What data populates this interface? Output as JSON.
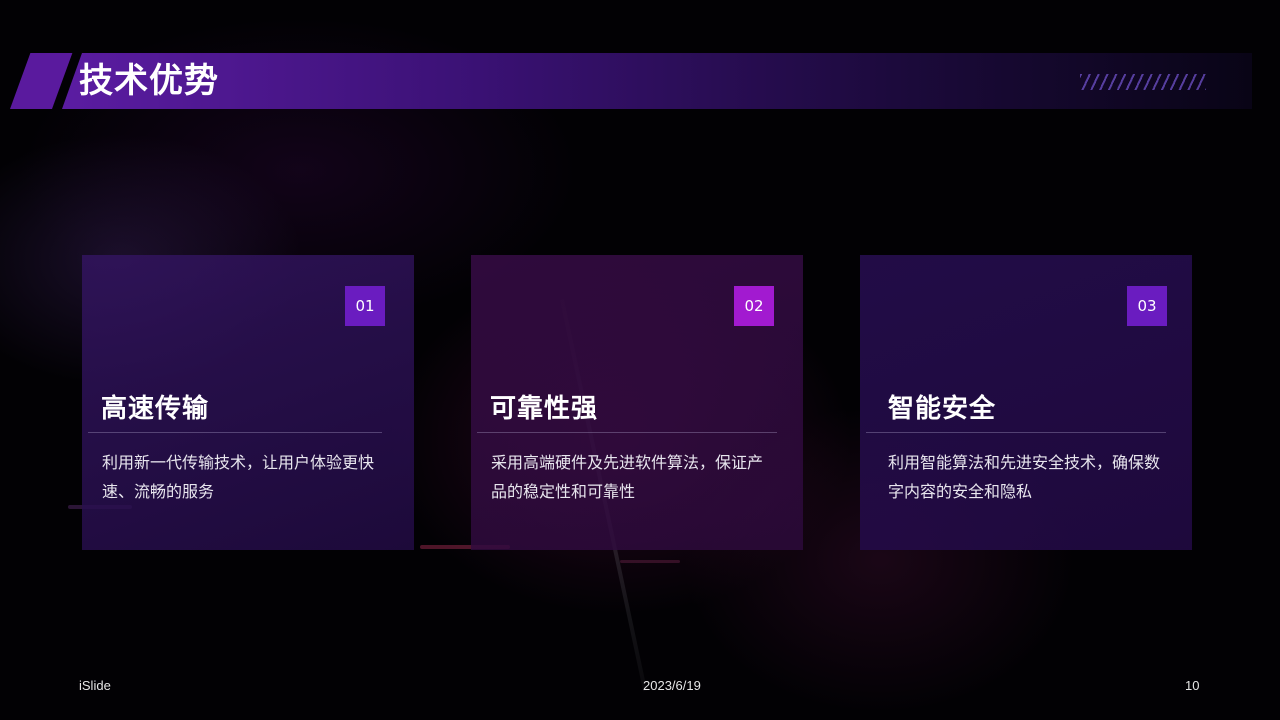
{
  "title": "技术优势",
  "cards": [
    {
      "number": "01",
      "title": "高速传输",
      "description": "利用新一代传输技术，让用户体验更快速、流畅的服务"
    },
    {
      "number": "02",
      "title": "可靠性强",
      "description": "采用高端硬件及先进软件算法，保证产品的稳定性和可靠性"
    },
    {
      "number": "03",
      "title": "智能安全",
      "description": "利用智能算法和先进安全技术，确保数字内容的安全和隐私"
    }
  ],
  "footer": {
    "brand": "iSlide",
    "date": "2023/6/19",
    "page_number": "10"
  },
  "colors": {
    "background": "#020104",
    "banner_accent": "#5b1ca2",
    "badge_purple": "#6a1cc0",
    "badge_magenta": "#a21ad0",
    "text": "#ffffff"
  }
}
